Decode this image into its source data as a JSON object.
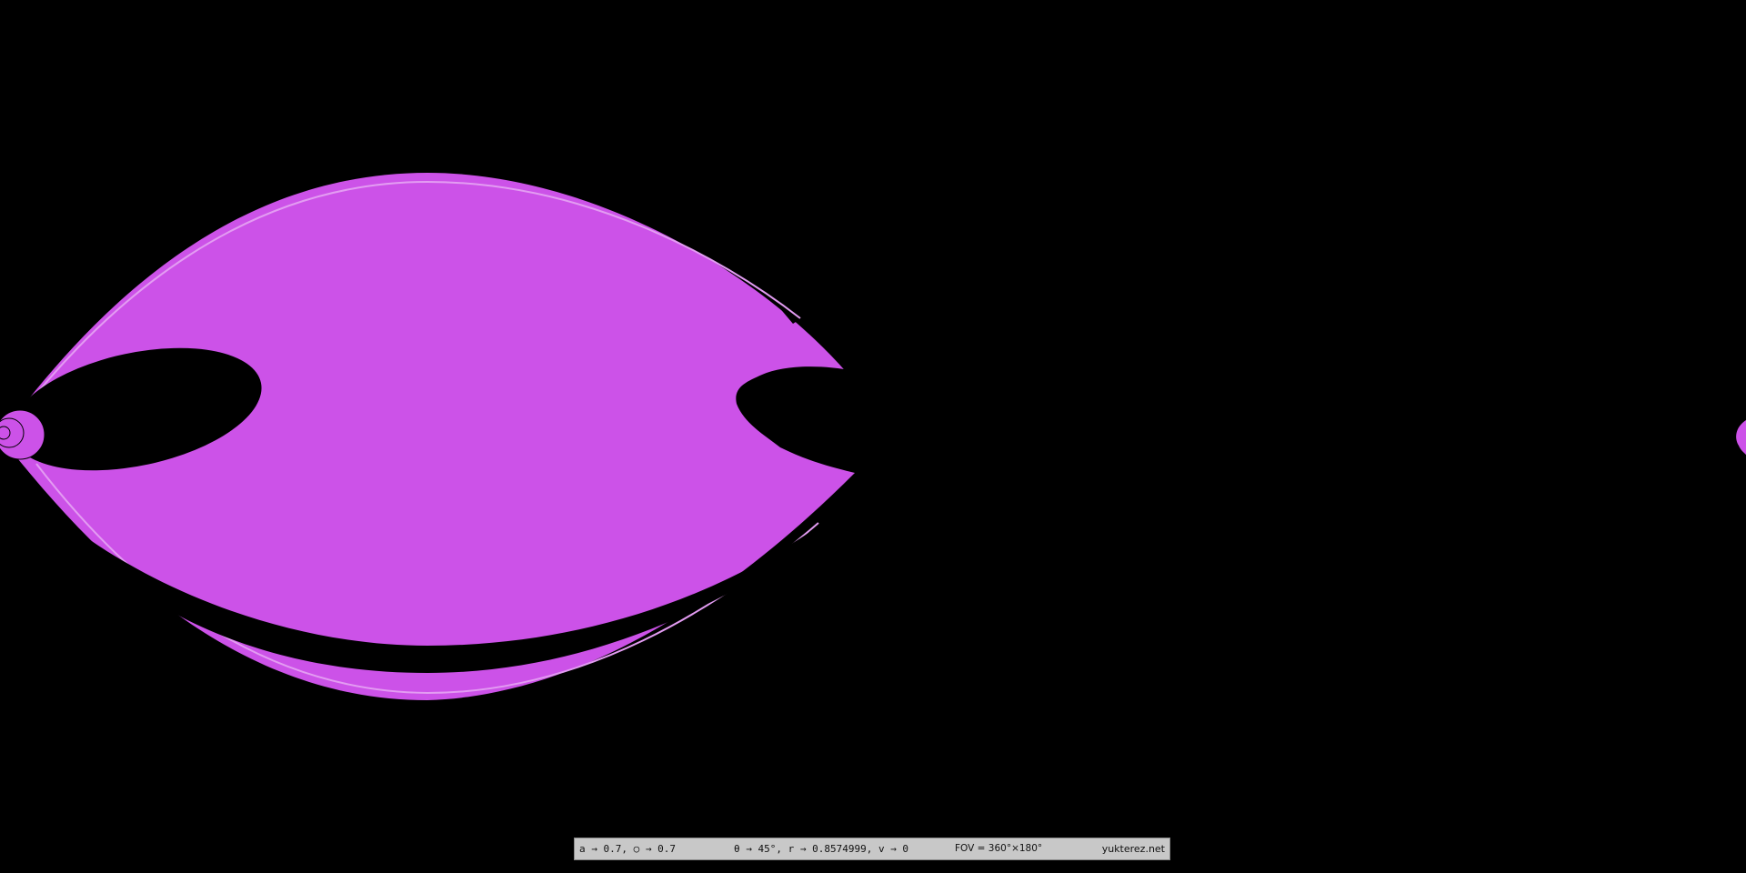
{
  "colors": {
    "background": "#000000",
    "shadow_fill": "#cc52e8",
    "shadow_rim": "#e39cf2",
    "status_bar_bg": "#c8c8c8",
    "status_bar_text": "#111111"
  },
  "status_bar": {
    "params": "a → 0.7, ○ → 0.7",
    "orbit": "θ → 45°, r → 0.8574999, v → 0",
    "fov": "FOV = 360°×180°",
    "site": "yukterez.net"
  }
}
